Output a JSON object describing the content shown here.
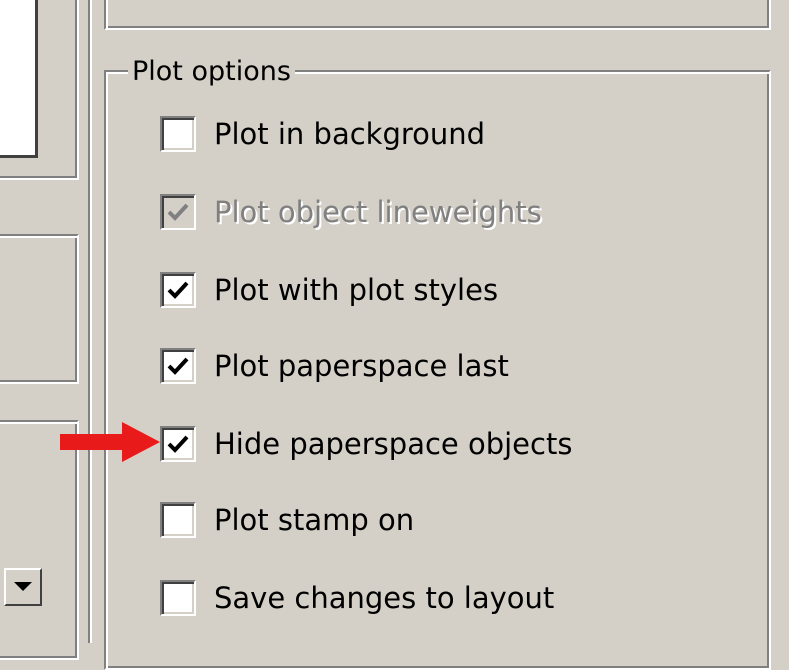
{
  "plot_options": {
    "title": "Plot options",
    "items": [
      {
        "label": "Plot in background",
        "checked": false,
        "disabled": false
      },
      {
        "label": "Plot object lineweights",
        "checked": true,
        "disabled": true
      },
      {
        "label": "Plot with plot styles",
        "checked": true,
        "disabled": false
      },
      {
        "label": "Plot paperspace last",
        "checked": true,
        "disabled": false
      },
      {
        "label": "Hide paperspace objects",
        "checked": true,
        "disabled": false
      },
      {
        "label": "Plot stamp on",
        "checked": false,
        "disabled": false
      },
      {
        "label": "Save changes to layout",
        "checked": false,
        "disabled": false
      }
    ]
  },
  "annotation": {
    "arrow_icon": "red-arrow-icon",
    "arrow_color": "#e81a1a",
    "points_to": "Hide paperspace objects"
  },
  "icons": {
    "checkmark": "checkmark-icon",
    "dropdown": "chevron-down-icon"
  },
  "colors": {
    "dialog_background": "#d4d0c8",
    "disabled_text": "#808080",
    "annotation_red": "#e81a1a"
  }
}
